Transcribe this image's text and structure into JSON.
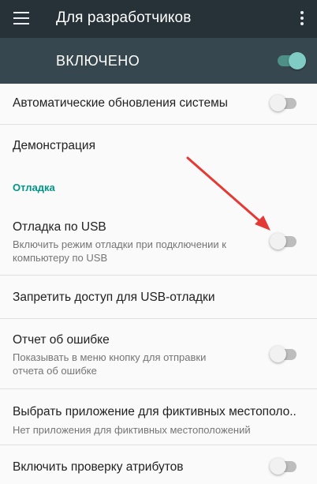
{
  "toolbar": {
    "title": "Для разработчиков",
    "menu_icon": "hamburger-menu-icon",
    "overflow_icon": "more-vert-icon"
  },
  "master_switch": {
    "label": "ВКЛЮЧЕНО",
    "state": "on"
  },
  "settings": {
    "auto_updates": {
      "title": "Автоматические обновления системы",
      "switch": "off"
    },
    "demo": {
      "title": "Демонстрация"
    },
    "debug_section": {
      "header": "Отладка"
    },
    "usb_debug": {
      "title": "Отладка по USB",
      "summary_line1": "Включить режим отладки при подключении к",
      "summary_line2": "компьютеру по USB",
      "switch": "off"
    },
    "revoke_usb": {
      "title": "Запретить доступ для USB-отладки"
    },
    "bug_report": {
      "title": "Отчет об ошибке",
      "summary_line1": "Показывать в меню кнопку для отправки",
      "summary_line2": "отчета об ошибке",
      "switch": "off"
    },
    "mock_location": {
      "title": "Выбрать приложение для фиктивных местополо..",
      "summary": "Нет приложения для фиктивных местоположений"
    },
    "verify_attributes": {
      "title": "Включить проверку атрибутов",
      "switch": "off"
    }
  },
  "colors": {
    "toolbar_bg": "#263238",
    "master_bar_bg": "#37474f",
    "accent": "#009688",
    "arrow": "#e53935"
  }
}
